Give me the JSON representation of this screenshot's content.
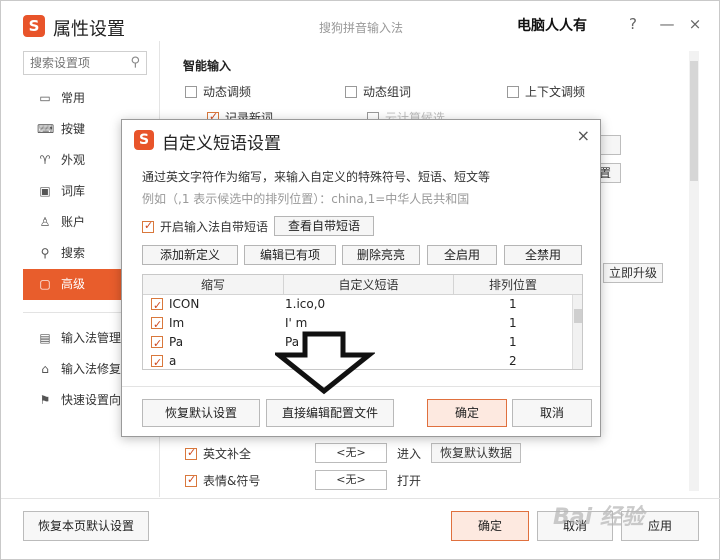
{
  "window": {
    "title": "属性设置",
    "subtitle": "搜狗拼音输入法",
    "watermark": "电脑人人有",
    "help": "?",
    "minimize": "—",
    "close": "×"
  },
  "sidebar": {
    "search_placeholder": "搜索设置项",
    "items": [
      {
        "label": "常用",
        "icon": "monitor-icon",
        "glyph": "▭"
      },
      {
        "label": "按键",
        "icon": "keyboard-icon",
        "glyph": "⌨"
      },
      {
        "label": "外观",
        "icon": "shirt-icon",
        "glyph": "♈"
      },
      {
        "label": "词库",
        "icon": "book-icon",
        "glyph": "▣"
      },
      {
        "label": "账户",
        "icon": "user-icon",
        "glyph": "♙"
      },
      {
        "label": "搜索",
        "icon": "search-icon",
        "glyph": "⚲"
      },
      {
        "label": "高级",
        "icon": "advanced-icon",
        "glyph": "▢"
      }
    ],
    "tools": [
      {
        "label": "输入法管理",
        "icon": "manager-icon",
        "glyph": "▤"
      },
      {
        "label": "输入法修复",
        "icon": "repair-icon",
        "glyph": "⌂"
      },
      {
        "label": "快速设置向",
        "icon": "flag-icon",
        "glyph": "⚑"
      }
    ]
  },
  "main": {
    "section_title": "智能输入",
    "options": {
      "dynamic_freq": "动态调频",
      "dynamic_words": "动态组词",
      "context": "上下文调频",
      "record_new": "记录新词",
      "cloud": "云计算候选"
    },
    "upgrade_button": "立即升级",
    "settings_button": "置",
    "eng_complete": "英文补全",
    "eng_value": "<无>",
    "eng_action": "进入",
    "restore_data": "恢复默认数据",
    "emoji": "表情&符号",
    "emoji_value": "<无>",
    "emoji_action": "打开"
  },
  "dialog": {
    "title": "自定义短语设置",
    "close": "×",
    "description": "通过英文字符作为缩写，来输入自定义的特殊符号、短语、短文等",
    "example": "例如（,1 表示候选中的排列位置）：china,1=中华人民共和国",
    "enable_builtin": "开启输入法自带短语",
    "view_builtin": "查看自带短语",
    "toolbar": {
      "add": "添加新定义",
      "edit": "编辑已有项",
      "delete": "删除亮亮",
      "enable_all": "全启用",
      "disable_all": "全禁用"
    },
    "table": {
      "headers": [
        "缩写",
        "自定义短语",
        "排列位置"
      ],
      "rows": [
        {
          "abbr": "ICON",
          "phrase": "1.ico,0",
          "pos": "1"
        },
        {
          "abbr": "Im",
          "phrase": "I' m",
          "pos": "1"
        },
        {
          "abbr": "Pa",
          "phrase": "Pa",
          "pos": "1"
        },
        {
          "abbr": "a",
          "phrase": "",
          "pos": "2"
        }
      ]
    },
    "footer": {
      "restore": "恢复默认设置",
      "edit_file": "直接编辑配置文件",
      "ok": "确定",
      "cancel": "取消"
    }
  },
  "bottom": {
    "restore_page": "恢复本页默认设置",
    "ok": "确定",
    "cancel": "取消",
    "apply": "应用"
  },
  "baidu_mark": "Bai 经验"
}
